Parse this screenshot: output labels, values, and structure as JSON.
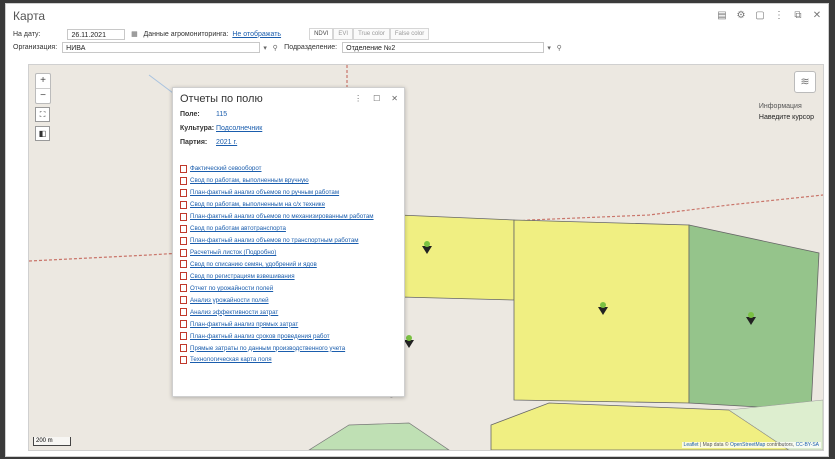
{
  "window": {
    "title": "Карта"
  },
  "filters": {
    "date_label": "На дату:",
    "date_value": "26.11.2021",
    "agro_label": "Данные агромониторинга:",
    "agro_link": "Не отображать",
    "index_buttons": [
      "NDVI",
      "EVI",
      "True color",
      "False color"
    ],
    "org_label": "Организация:",
    "org_value": "НИВА",
    "division_label": "Подразделение:",
    "division_value": "Отделение №2"
  },
  "map": {
    "zoom_in": "+",
    "zoom_out": "−",
    "info_title": "Информация",
    "info_hint": "Наведите курсор",
    "scale": "200 m",
    "attribution_leaflet": "Leaflet",
    "attribution_mid": "| Map data ©",
    "attribution_osm": "OpenStreetMap",
    "attribution_end": "contributors,",
    "attribution_cc": "CC-BY-SA",
    "colors": {
      "bg": "#ece8e1",
      "field_yellow": "#f0ef82",
      "field_green": "#95c48b",
      "field_light_green": "#bfe0b4",
      "border_dashed": "#c9756a"
    }
  },
  "panel": {
    "title": "Отчеты по полю",
    "field_label": "Поле:",
    "field_value": "115",
    "crop_label": "Культура:",
    "crop_value": "Подсолнечник",
    "batch_label": "Партия:",
    "batch_value": "2021 г.",
    "reports": [
      "Фактический севооборот",
      "Свод по работам, выполненным вручную",
      "План-фактный анализ объемов по ручным работам",
      "Свод по работам, выполненным на с/х технике",
      "План-фактный анализ объемов по механизированным работам",
      "Свод по работам автотранспорта",
      "План-фактный анализ объемов по транспортным работам",
      "Расчетный листок (Подробно)",
      "Свод по списанию семян, удобрений и ядов",
      "Свод по регистрациям взвешивания",
      "Отчет по урожайности полей",
      "Анализ урожайности полей",
      "Анализ эффективности затрат",
      "План-фактный анализ прямых затрат",
      "План-фактный анализ сроков проведения работ",
      "Прямые затраты по данным производственного учета",
      "Технологическая карта поля"
    ]
  }
}
